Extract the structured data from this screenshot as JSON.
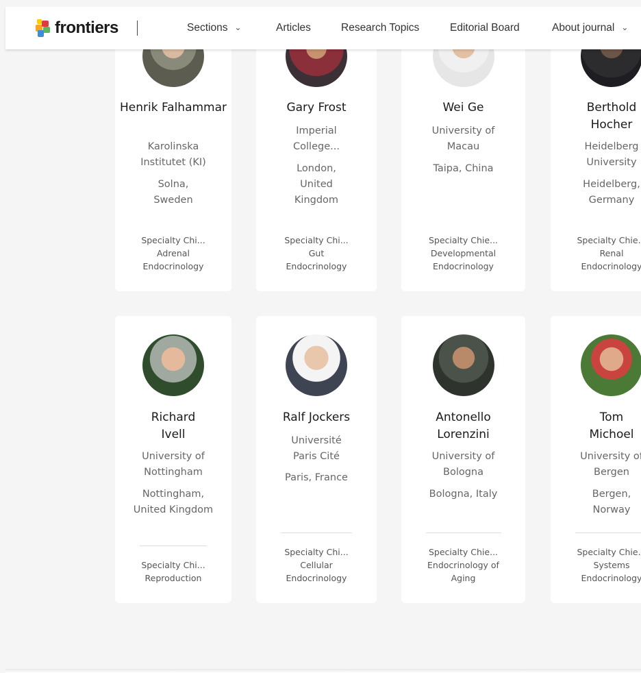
{
  "header": {
    "logo_text": "frontiers",
    "nav": [
      {
        "label": "Sections",
        "has_dropdown": true
      },
      {
        "label": "Articles",
        "has_dropdown": false
      },
      {
        "label": "Research Topics",
        "has_dropdown": false
      },
      {
        "label": "Editorial Board",
        "has_dropdown": false
      },
      {
        "label": "About journal",
        "has_dropdown": true
      }
    ]
  },
  "colors": {
    "logo_orange": "#f5a623",
    "logo_red": "#e03a3e",
    "logo_green": "#5cb85c",
    "logo_blue": "#3b8fd9",
    "logo_yellow": "#ffcc00"
  },
  "editors": [
    {
      "name": "Henrik Falhammar",
      "institution": "Karolinska Institutet (KI)",
      "location": "Solna, Sweden",
      "role": [
        "Specialty Chi...",
        "Adrenal",
        "Endocrinology"
      ]
    },
    {
      "name": "Gary Frost",
      "institution": "Imperial College...",
      "location": "London, United Kingdom",
      "role": [
        "Specialty Chi...",
        "Gut",
        "Endocrinology"
      ]
    },
    {
      "name": "Wei Ge",
      "institution": "University of Macau",
      "location": "Taipa, China",
      "role": [
        "Specialty Chie...",
        "Developmental",
        "Endocrinology"
      ]
    },
    {
      "name": "Berthold Hocher",
      "institution": "Heidelberg University",
      "location": "Heidelberg, Germany",
      "role": [
        "Specialty Chie...",
        "Renal",
        "Endocrinology"
      ]
    },
    {
      "name": "Richard Ivell",
      "institution": "University of Nottingham",
      "location": "Nottingham, United Kingdom",
      "role": [
        "Specialty Chi...",
        "Reproduction"
      ]
    },
    {
      "name": "Ralf Jockers",
      "institution": "Université Paris Cité",
      "location": "Paris, France",
      "role": [
        "Specialty Chi...",
        "Cellular",
        "Endocrinology"
      ]
    },
    {
      "name": "Antonello Lorenzini",
      "institution": "University of Bologna",
      "location": "Bologna, Italy",
      "role": [
        "Specialty Chie...",
        "Endocrinology of",
        "Aging"
      ]
    },
    {
      "name": "Tom Michoel",
      "institution": "University of Bergen",
      "location": "Bergen, Norway",
      "role": [
        "Specialty Chie...",
        "Systems",
        "Endocrinology"
      ]
    }
  ]
}
